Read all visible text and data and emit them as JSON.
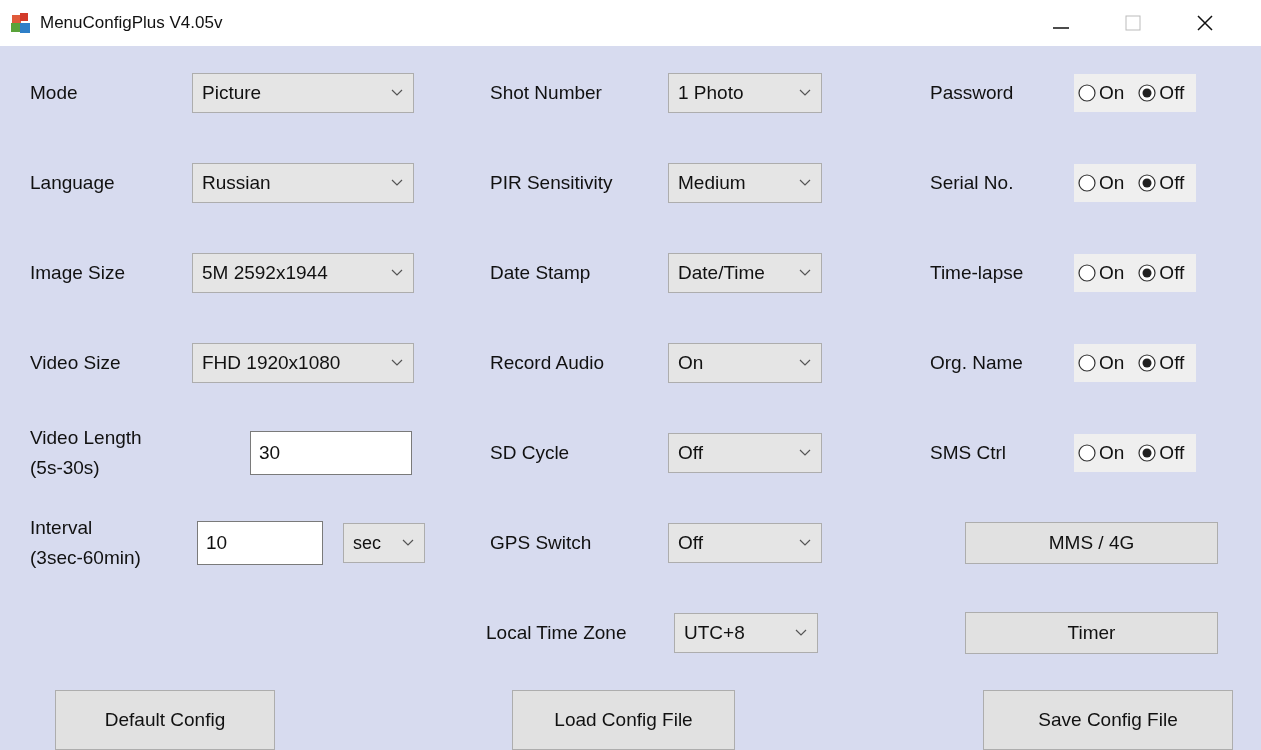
{
  "window": {
    "title": "MenuConfigPlus V4.05v"
  },
  "left": [
    {
      "kind": "select",
      "label": "Mode",
      "value": "Picture"
    },
    {
      "kind": "select",
      "label": "Language",
      "value": "Russian"
    },
    {
      "kind": "select",
      "label": "Image Size",
      "value": "5M  2592x1944"
    },
    {
      "kind": "select",
      "label": "Video Size",
      "value": "FHD 1920x1080"
    },
    {
      "kind": "input",
      "label": "Video Length",
      "hint": "(5s-30s)",
      "value": "30"
    },
    {
      "kind": "input_unit",
      "label": "Interval",
      "hint": "(3sec-60min)",
      "value": "10",
      "unit": "sec"
    }
  ],
  "middle": [
    {
      "kind": "select",
      "label": "Shot Number",
      "value": "1 Photo"
    },
    {
      "kind": "select",
      "label": "PIR Sensitivity",
      "value": "Medium"
    },
    {
      "kind": "select",
      "label": "Date Stamp",
      "value": "Date/Time"
    },
    {
      "kind": "select",
      "label": "Record Audio",
      "value": "On"
    },
    {
      "kind": "select",
      "label": "SD Cycle",
      "value": "Off"
    },
    {
      "kind": "select",
      "label": "GPS Switch",
      "value": "Off"
    },
    {
      "kind": "select_wide",
      "label": "Local Time Zone",
      "value": "UTC+8"
    }
  ],
  "right": [
    {
      "kind": "radio",
      "label": "Password",
      "options": [
        {
          "label": "On",
          "selected": false
        },
        {
          "label": "Off",
          "selected": true
        }
      ]
    },
    {
      "kind": "radio",
      "label": "Serial No.",
      "options": [
        {
          "label": "On",
          "selected": false
        },
        {
          "label": "Off",
          "selected": true
        }
      ]
    },
    {
      "kind": "radio",
      "label": "Time-lapse",
      "options": [
        {
          "label": "On",
          "selected": false
        },
        {
          "label": "Off",
          "selected": true
        }
      ]
    },
    {
      "kind": "radio",
      "label": "Org. Name",
      "options": [
        {
          "label": "On",
          "selected": false
        },
        {
          "label": "Off",
          "selected": true
        }
      ]
    },
    {
      "kind": "radio",
      "label": "SMS Ctrl",
      "options": [
        {
          "label": "On",
          "selected": false
        },
        {
          "label": "Off",
          "selected": true
        }
      ]
    },
    {
      "kind": "button",
      "label": "MMS / 4G"
    },
    {
      "kind": "button",
      "label": "Timer"
    }
  ],
  "bottom_buttons": [
    "Default Config",
    "Load Config File",
    "Save Config File"
  ]
}
